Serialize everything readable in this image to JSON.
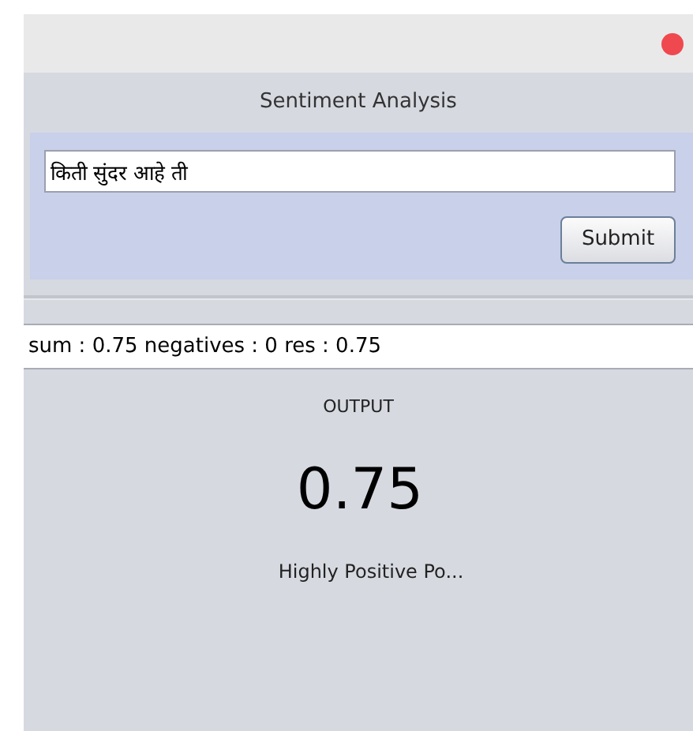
{
  "window": {
    "title": "Sentiment Analysis"
  },
  "input": {
    "value": "किती सुंदर आहे ती"
  },
  "submit_button": {
    "label": "Submit"
  },
  "details_field": {
    "value": "sum : 0.75 negatives : 0 res : 0.75"
  },
  "output": {
    "heading": "OUTPUT",
    "score": "0.75",
    "verdict": "Highly Positive Po..."
  }
}
